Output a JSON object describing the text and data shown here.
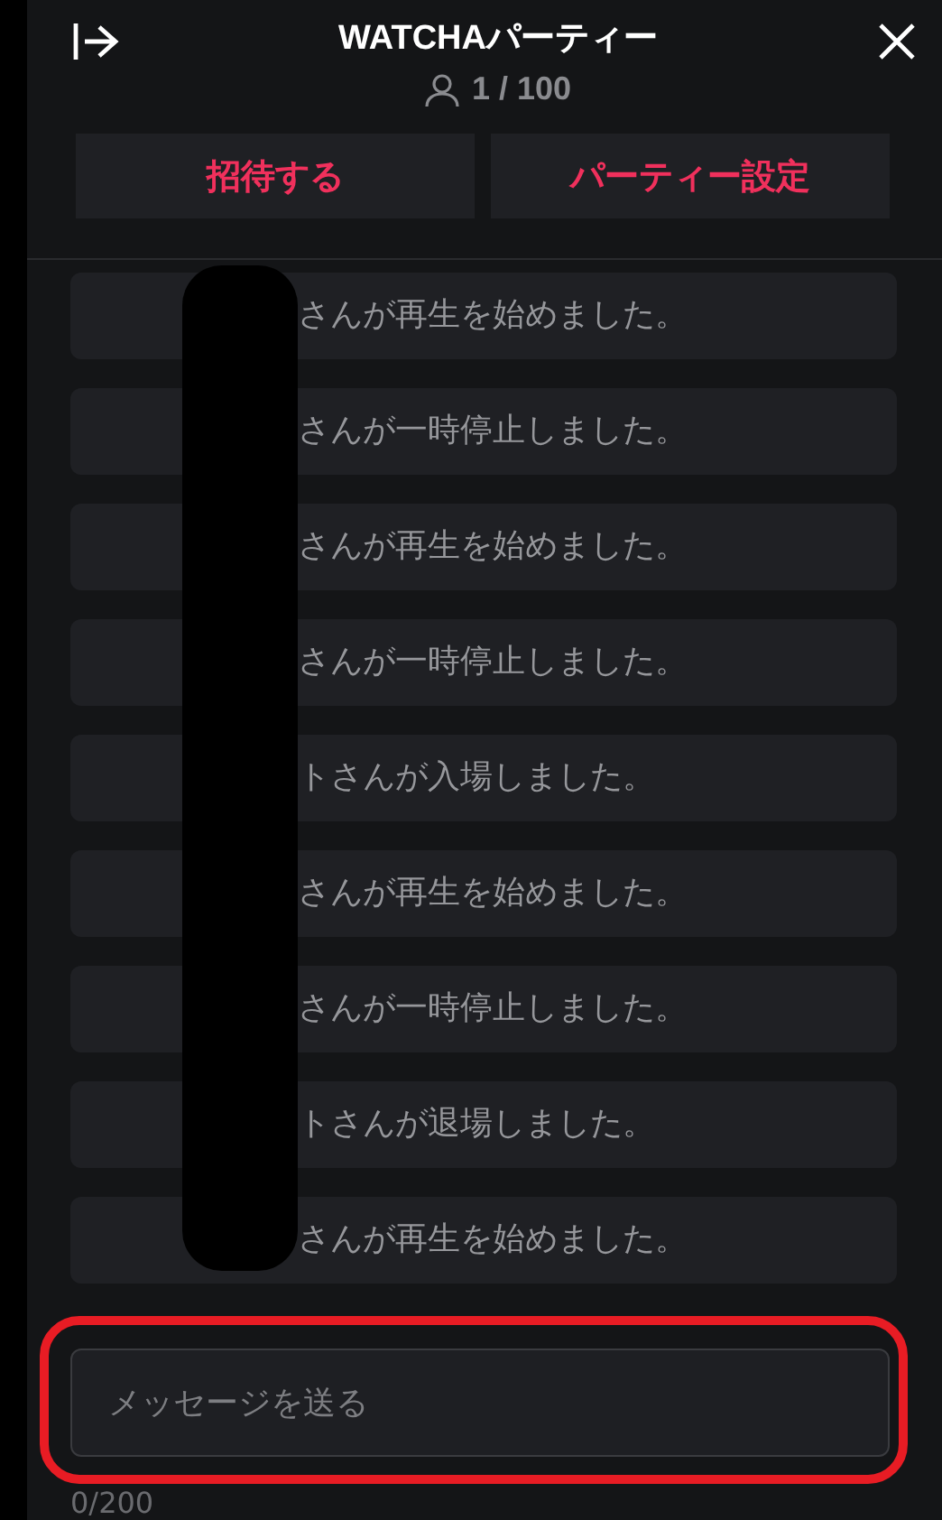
{
  "header": {
    "title": "WATCHAパーティー",
    "member_count": "1 / 100"
  },
  "buttons": [
    "招待する",
    "パーティー設定"
  ],
  "messages": [
    "さんが再生を始めました。",
    "さんが一時停止しました。",
    "さんが再生を始めました。",
    "さんが一時停止しました。",
    "トさんが入場しました。",
    "さんが再生を始めました。",
    "さんが一時停止しました。",
    "トさんが退場しました。",
    "さんが再生を始めました。"
  ],
  "message_input": {
    "placeholder": "メッセージを送る"
  },
  "char_counter": "0/200"
}
